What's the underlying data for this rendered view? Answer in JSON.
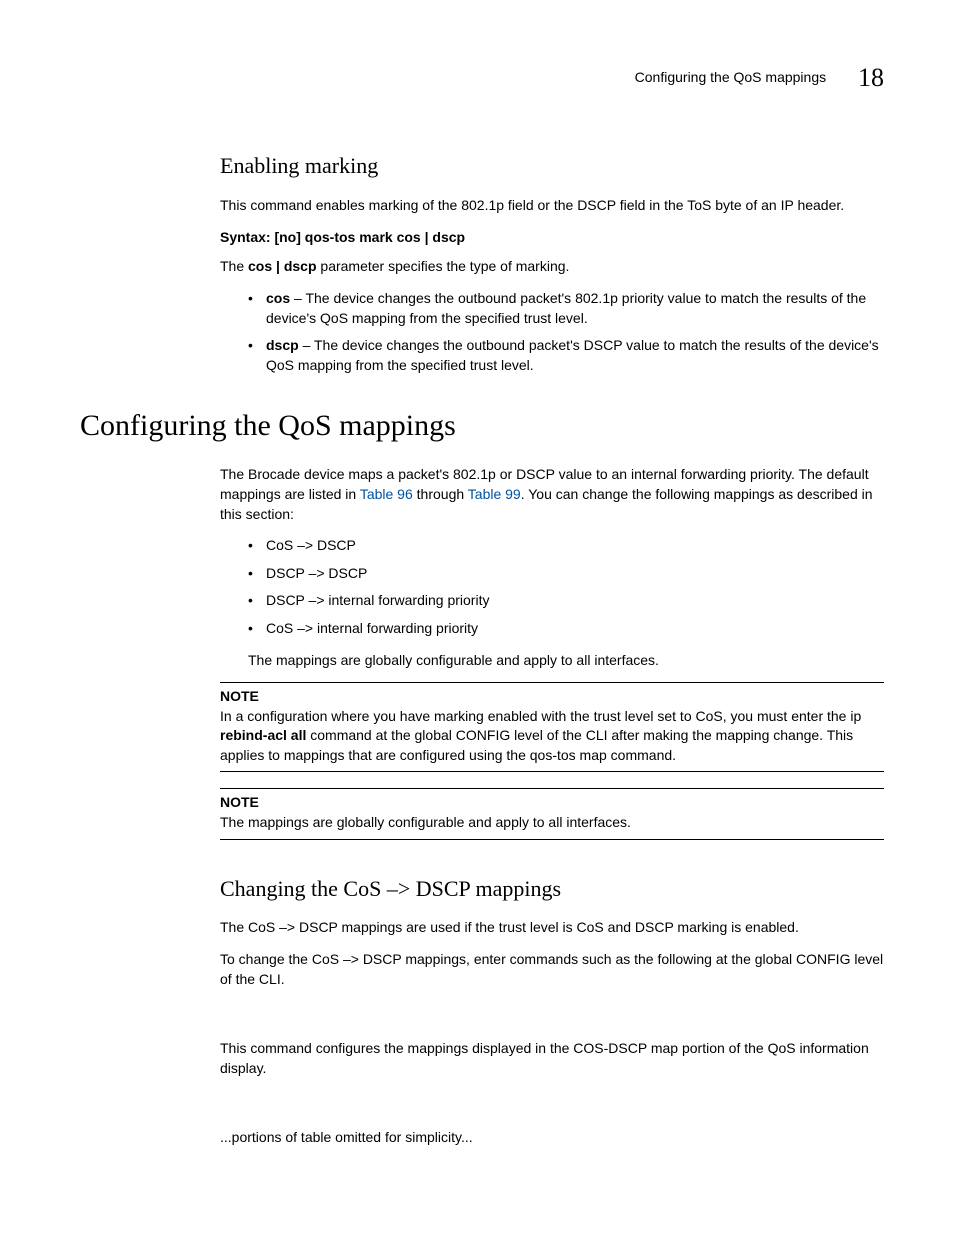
{
  "header": {
    "running_title": "Configuring the QoS mappings",
    "chapter_number": "18"
  },
  "section1": {
    "heading": "Enabling marking",
    "intro": "This command enables marking of the 802.1p field or  the DSCP field in the ToS byte of an IP header.",
    "syntax_label": "Syntax:",
    "syntax_body": "  [no] qos-tos mark cos | dscp",
    "param_sentence_pre": "The ",
    "param_bold": "cos | dscp",
    "param_sentence_post": " parameter specifies the type of marking.",
    "bullets": [
      {
        "term": "cos",
        "desc": " – The device changes the outbound packet's 802.1p priority value to match the results of the device's QoS mapping from the specified trust level."
      },
      {
        "term": "dscp",
        "desc": " – The device changes the outbound packet's DSCP value to match the results of the device's QoS mapping from the specified trust level."
      }
    ]
  },
  "section2": {
    "heading": "Configuring the QoS mappings",
    "intro_pre": "The Brocade device maps a packet's 802.1p or DSCP value to an internal forwarding priority. The default mappings are listed in ",
    "link1": "Table 96",
    "intro_mid": " through ",
    "link2": "Table 99",
    "intro_post": ". You can change the following mappings as described in this section:",
    "bullets": [
      "CoS –> DSCP",
      "DSCP –> DSCP",
      "DSCP –> internal forwarding priority",
      "CoS –> internal forwarding priority"
    ],
    "after_bullets": "The mappings are globally configurable and apply to all interfaces.",
    "note1": {
      "label": "NOTE",
      "body_pre": "In a configuration where you have marking enabled with the trust level set to CoS, you must enter the ip ",
      "body_bold": "rebind-acl all",
      "body_post": " command at the global CONFIG level of the CLI after making the mapping change. This applies to mappings that are configured using the qos-tos map command."
    },
    "note2": {
      "label": "NOTE",
      "body": "The mappings are globally configurable and apply to all interfaces."
    }
  },
  "section3": {
    "heading": "Changing the CoS –> DSCP mappings",
    "p1": "The CoS –> DSCP mappings are used if the trust level is CoS and DSCP marking is enabled.",
    "p2": "To change the CoS –> DSCP mappings, enter commands such as the following at the global CONFIG level of the CLI.",
    "p3": "This command configures the mappings displayed in the COS-DSCP map portion of the QoS information display.",
    "p4": "...portions of table omitted for simplicity..."
  }
}
